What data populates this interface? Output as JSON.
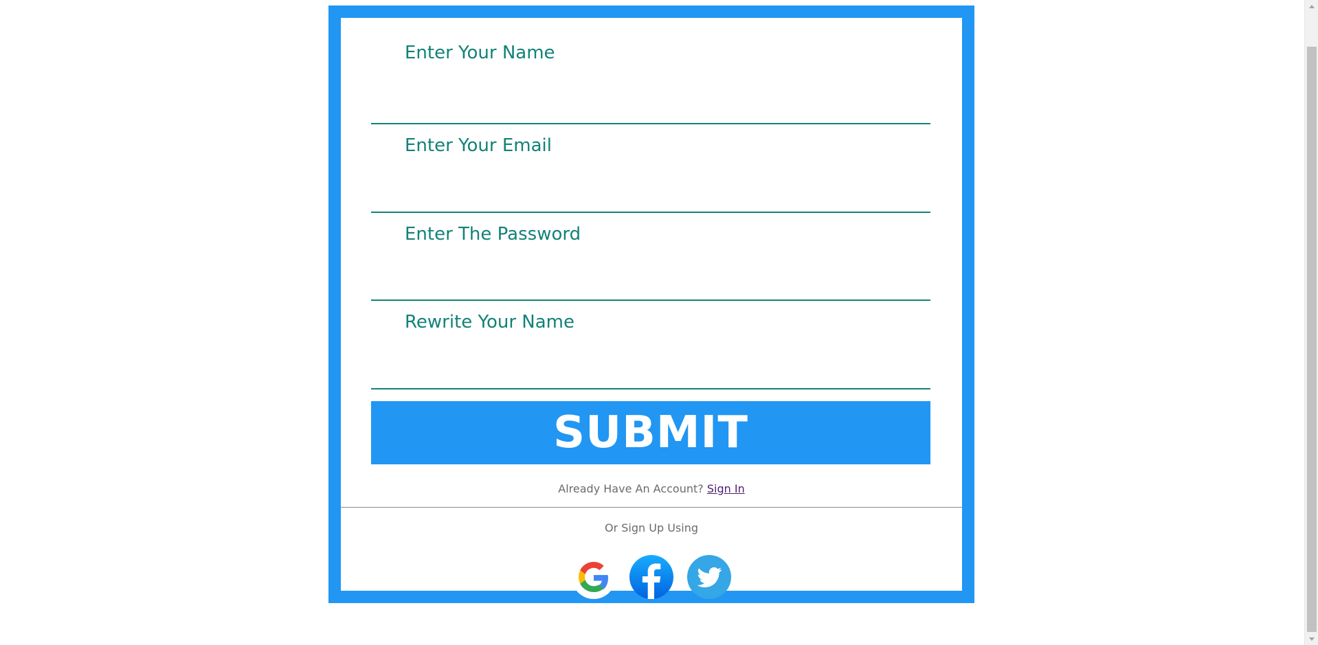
{
  "form": {
    "fields": [
      {
        "label": "Enter Your Name",
        "value": ""
      },
      {
        "label": "Enter Your Email",
        "value": ""
      },
      {
        "label": "Enter The Password",
        "value": ""
      },
      {
        "label": "Rewrite Your Name",
        "value": ""
      }
    ],
    "submit_label": "SUBMIT",
    "already_text": "Already Have An Account?",
    "sign_in_label": "Sign In",
    "or_sign_up_text": "Or Sign Up Using"
  },
  "socials": [
    {
      "name": "google-icon"
    },
    {
      "name": "facebook-icon"
    },
    {
      "name": "twitter-icon"
    }
  ],
  "colors": {
    "accent": "#2196f3",
    "field_text": "#128277",
    "muted_text": "#6b6b6b",
    "link": "#4b1f6f"
  }
}
